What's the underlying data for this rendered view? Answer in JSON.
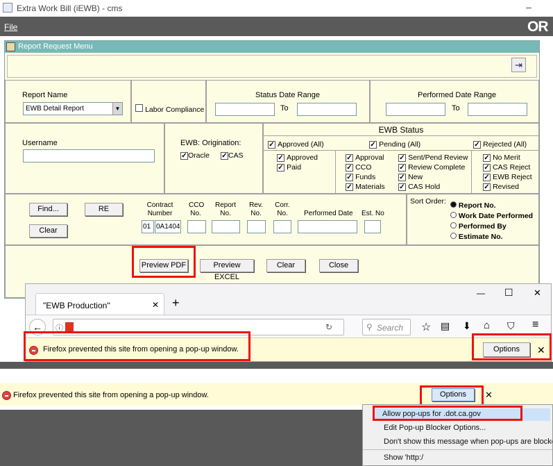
{
  "window": {
    "title": "Extra Work Bill (iEWB) - cms",
    "minimize": "–"
  },
  "menubar": {
    "file": "File",
    "logo": "OR"
  },
  "inner": {
    "title": "Report Request Menu",
    "exit_icon": "exit-icon"
  },
  "report": {
    "name_label": "Report Name",
    "name_value": "EWB Detail Report",
    "labor": "Labor Compliance",
    "status_range": "Status Date Range",
    "to1": "To",
    "perf_range": "Performed Date Range",
    "to2": "To"
  },
  "user": {
    "label": "Username",
    "origin_label": "EWB: Origination:",
    "oracle": "Oracle",
    "cas": "CAS"
  },
  "status": {
    "title": "EWB Status",
    "approved_all": "Approved (All)",
    "pending_all": "Pending (All)",
    "rejected_all": "Rejected (All)",
    "col1": [
      "Approved",
      "Paid"
    ],
    "col2": [
      "Approval",
      "CCO",
      "Funds",
      "Materials"
    ],
    "col3": [
      "Sent/Pend Review",
      "Review Complete",
      "New",
      "CAS Hold"
    ],
    "col4": [
      "No Merit",
      "CAS Reject",
      "EWB Reject",
      "Revised"
    ]
  },
  "search": {
    "find": "Find...",
    "re": "RE",
    "clear": "Clear",
    "contract_number": "Contract Number",
    "cco": "CCO No.",
    "report_no": "Report No.",
    "rev": "Rev. No.",
    "corr": "Corr. No.",
    "perf_date": "Performed Date",
    "est": "Est. No",
    "contract_prefix": "01",
    "contract_value": "0A1404"
  },
  "sort": {
    "label": "Sort Order:",
    "options": [
      "Report No.",
      "Work Date Performed",
      "Performed By",
      "Estimate No."
    ]
  },
  "actions": {
    "preview_pdf": "Preview PDF",
    "preview_excel": "Preview EXCEL",
    "clear": "Clear",
    "close": "Close"
  },
  "firefox": {
    "tab_title": "\"EWB Production\"",
    "tab_close": "✕",
    "new_tab": "+",
    "search_placeholder": "Search",
    "popup_msg": "Firefox prevented this site from opening a pop-up window.",
    "options": "Options",
    "close": "✕",
    "win_min": "—",
    "win_max": "☐",
    "win_close": "✕"
  },
  "notif2": {
    "msg": "Firefox prevented this site from opening a pop-up window.",
    "options": "Options",
    "close": "✕"
  },
  "menu": {
    "items": [
      "Allow pop-ups for            .dot.ca.gov",
      "Edit Pop-up Blocker Options...",
      "Don't show this message when pop-ups are blocked",
      "Show 'http:/"
    ]
  },
  "colors": {
    "panel": "#fdfde4",
    "title": "#77b9b6",
    "highlight": "#e11111",
    "gray": "#595959"
  }
}
